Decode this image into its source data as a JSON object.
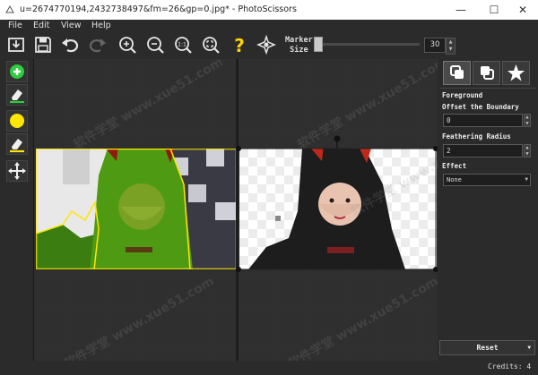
{
  "window": {
    "title": "u=2674770194,2432738497&fm=26&gp=0.jpg* - PhotoScissors",
    "minimize": "—",
    "maximize": "☐",
    "close": "✕"
  },
  "menu": [
    "File",
    "Edit",
    "View",
    "Help"
  ],
  "toolbar": {
    "icons": [
      "open-icon",
      "save-icon",
      "undo-icon",
      "redo-icon",
      "zoom-in-icon",
      "zoom-out-icon",
      "zoom-actual-icon",
      "zoom-fit-icon",
      "help-icon",
      "settings-icon"
    ],
    "marker_label_line1": "Marker",
    "marker_label_line2": "Size",
    "marker_size_value": "30"
  },
  "left_tools": [
    "foreground-marker-icon",
    "foreground-eraser-icon",
    "background-marker-icon",
    "background-eraser-icon",
    "move-icon"
  ],
  "watermark": "软件学堂 www.xue51.com",
  "panel": {
    "tabs": [
      "foreground-tab",
      "background-tab",
      "effects-tab"
    ],
    "section_title": "Foreground",
    "offset_label": "Offset the Boundary",
    "offset_value": "0",
    "feathering_label": "Feathering Radius",
    "feathering_value": "2",
    "effect_label": "Effect",
    "effect_value": "None",
    "reset_label": "Reset"
  },
  "status": {
    "credits": "Credits: 4"
  },
  "colors": {
    "accent_green": "#2ecc40",
    "accent_yellow": "#ffe600",
    "help_yellow": "#ffd400"
  }
}
